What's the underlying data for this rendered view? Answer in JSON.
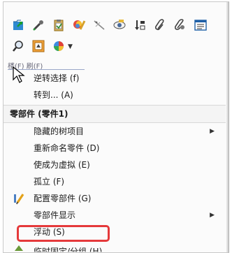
{
  "toolbar": {
    "row1": [
      "open-in-folder-icon",
      "eyedropper-icon",
      "clipboard-icon",
      "edit-appearance-icon",
      "hide-sketch-icon",
      "show-eye-icon",
      "sort-order-icon",
      "paperclip-icon",
      "link-chain-icon",
      "properties-list-icon"
    ],
    "row2": [
      "zoom-search-icon",
      "frame-view-icon",
      "appearance-palette-icon"
    ]
  },
  "tab_stub_text": "楼(F)     刷(F)",
  "menu": {
    "items_top": [
      {
        "label": "逆转选择 (f)",
        "has_icon": false
      },
      {
        "label": "转到... (A)",
        "has_icon": false
      }
    ],
    "section_header": "零部件 (零件1)",
    "items": [
      {
        "label": "隐藏的树项目",
        "submenu": true
      },
      {
        "label": "重新命名零件 (D)",
        "submenu": false
      },
      {
        "label": "使成为虚拟 (E)",
        "submenu": false
      },
      {
        "label": "孤立 (F)",
        "submenu": false
      },
      {
        "label": "配置零部件 (G)",
        "submenu": false,
        "icon": "configure-pencil-icon"
      },
      {
        "label": "零部件显示",
        "submenu": true
      },
      {
        "label": "浮动 (S)",
        "submenu": false
      },
      {
        "label": "临时固定/分组 (H)",
        "submenu": false
      }
    ]
  },
  "highlight_color": "#e5393b"
}
